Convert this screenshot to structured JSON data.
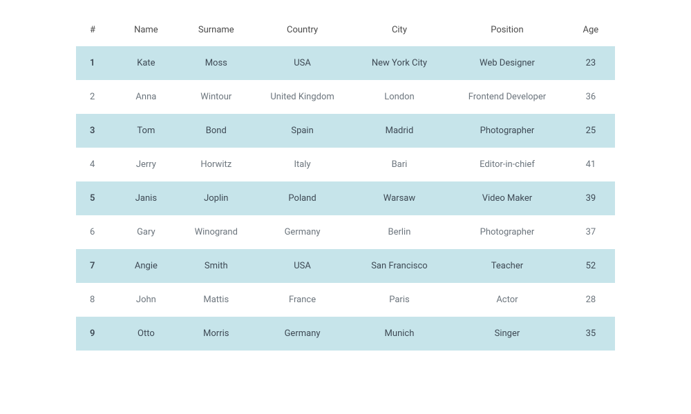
{
  "table": {
    "headers": {
      "num": "#",
      "name": "Name",
      "surname": "Surname",
      "country": "Country",
      "city": "City",
      "position": "Position",
      "age": "Age"
    },
    "rows": [
      {
        "num": "1",
        "name": "Kate",
        "surname": "Moss",
        "country": "USA",
        "city": "New York City",
        "position": "Web Designer",
        "age": "23"
      },
      {
        "num": "2",
        "name": "Anna",
        "surname": "Wintour",
        "country": "United Kingdom",
        "city": "London",
        "position": "Frontend Developer",
        "age": "36"
      },
      {
        "num": "3",
        "name": "Tom",
        "surname": "Bond",
        "country": "Spain",
        "city": "Madrid",
        "position": "Photographer",
        "age": "25"
      },
      {
        "num": "4",
        "name": "Jerry",
        "surname": "Horwitz",
        "country": "Italy",
        "city": "Bari",
        "position": "Editor-in-chief",
        "age": "41"
      },
      {
        "num": "5",
        "name": "Janis",
        "surname": "Joplin",
        "country": "Poland",
        "city": "Warsaw",
        "position": "Video Maker",
        "age": "39"
      },
      {
        "num": "6",
        "name": "Gary",
        "surname": "Winogrand",
        "country": "Germany",
        "city": "Berlin",
        "position": "Photographer",
        "age": "37"
      },
      {
        "num": "7",
        "name": "Angie",
        "surname": "Smith",
        "country": "USA",
        "city": "San Francisco",
        "position": "Teacher",
        "age": "52"
      },
      {
        "num": "8",
        "name": "John",
        "surname": "Mattis",
        "country": "France",
        "city": "Paris",
        "position": "Actor",
        "age": "28"
      },
      {
        "num": "9",
        "name": "Otto",
        "surname": "Morris",
        "country": "Germany",
        "city": "Munich",
        "position": "Singer",
        "age": "35"
      }
    ]
  }
}
